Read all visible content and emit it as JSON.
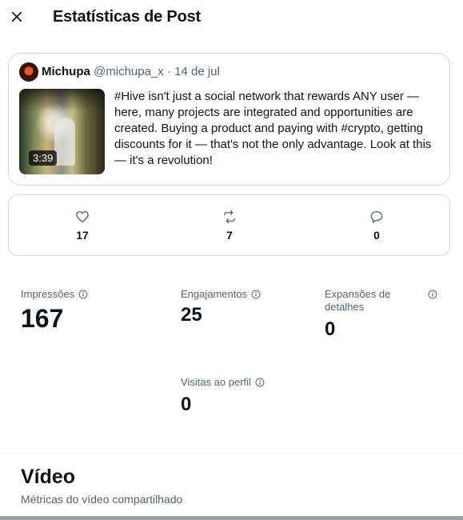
{
  "header": {
    "title": "Estatísticas de Post",
    "close_icon": "close-icon"
  },
  "post": {
    "author_name": "Michupa",
    "author_handle": "@michupa_x",
    "separator": "·",
    "date": "14 de jul",
    "video_duration": "3:39",
    "text": "#Hive isn't just a social network that rewards ANY user — here, many projects are integrated and opportunities are created. Buying a product and paying with #crypto, getting discounts for it — that's not the only advantage. Look at this — it's a revolution!"
  },
  "engagement": {
    "likes": "17",
    "reposts": "7",
    "replies": "0"
  },
  "metrics": {
    "impressions": {
      "label": "Impressões",
      "value": "167"
    },
    "engagements": {
      "label": "Engajamentos",
      "value": "25"
    },
    "detail_expands": {
      "label": "Expansões de detalhes",
      "value": "0"
    },
    "profile_visits": {
      "label": "Visitas ao perfil",
      "value": "0"
    }
  },
  "video_section": {
    "title": "Vídeo",
    "subtitle": "Métricas do vídeo compartilhado"
  },
  "colors": {
    "text_primary": "#0f1419",
    "text_secondary": "#536471",
    "border": "#cfd9de"
  }
}
